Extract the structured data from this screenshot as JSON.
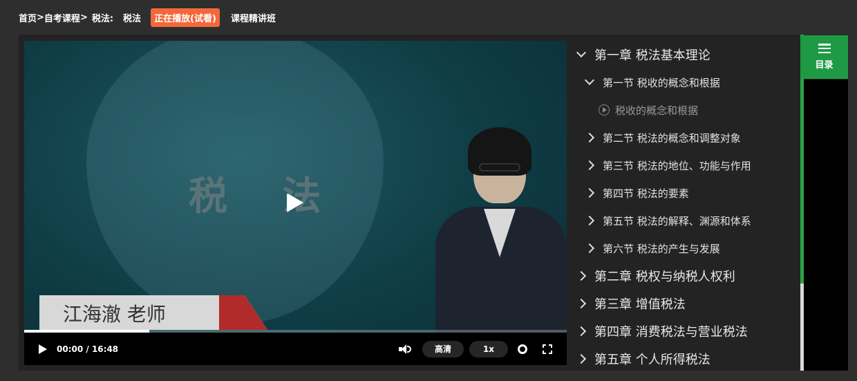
{
  "breadcrumb": {
    "home": "首页",
    "sep1": ">",
    "category": "自考课程",
    "sep2": ">",
    "subject_label": "税法:",
    "subject": "税法",
    "badge": "正在播放(试看)",
    "course": "课程精讲班"
  },
  "video": {
    "slide_title": "税 法",
    "teacher_name": "江海澈 老师",
    "current_time": "00:00",
    "time_sep": " / ",
    "duration": "16:48",
    "progress_fraction": 0.23,
    "quality": "高清",
    "speed": "1x"
  },
  "catalog": {
    "menu_label": "目录",
    "items": [
      {
        "level": "chapter",
        "expanded": true,
        "label": "第一章 税法基本理论"
      },
      {
        "level": "section",
        "expanded": true,
        "label": "第一节 税收的概念和根据"
      },
      {
        "level": "lesson",
        "label": "税收的概念和根据"
      },
      {
        "level": "section",
        "expanded": false,
        "label": "第二节 税法的概念和调整对象"
      },
      {
        "level": "section",
        "expanded": false,
        "label": "第三节 税法的地位、功能与作用"
      },
      {
        "level": "section",
        "expanded": false,
        "label": "第四节 税法的要素"
      },
      {
        "level": "section",
        "expanded": false,
        "label": "第五节 税法的解释、渊源和体系"
      },
      {
        "level": "section",
        "expanded": false,
        "label": "第六节 税法的产生与发展"
      },
      {
        "level": "chapter",
        "expanded": false,
        "label": "第二章 税权与纳税人权利"
      },
      {
        "level": "chapter",
        "expanded": false,
        "label": "第三章 增值税法"
      },
      {
        "level": "chapter",
        "expanded": false,
        "label": "第四章 消费税法与营业税法"
      },
      {
        "level": "chapter",
        "expanded": false,
        "label": "第五章 个人所得税法"
      }
    ]
  },
  "colors": {
    "badge": "#f2683b",
    "accent_green": "#1e9a45",
    "background": "#2e2e2e"
  }
}
